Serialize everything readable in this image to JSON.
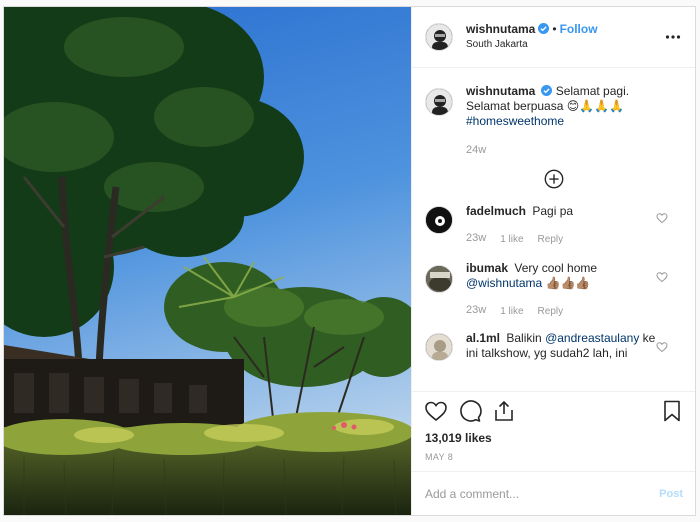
{
  "post": {
    "username": "wishnutama",
    "follow_label": "Follow",
    "location": "South Jakarta"
  },
  "caption": {
    "username": "wishnutama",
    "text": "Selamat pagi. Selamat berpuasa 😊🙏🙏🙏",
    "hashtag": "#homesweethome",
    "time": "24w"
  },
  "comments": [
    {
      "username": "fadelmuch",
      "text": "Pagi pa",
      "mention": "",
      "emoji": "",
      "time": "23w",
      "likes": "1 like",
      "reply": "Reply"
    },
    {
      "username": "ibumak",
      "text": "Very cool home",
      "mention": "@wishnutama",
      "emoji": " 👍🏽👍🏽👍🏽",
      "time": "23w",
      "likes": "1 like",
      "reply": "Reply"
    },
    {
      "username": "al.1ml",
      "text": "Balikin",
      "mention": "@andreastaulany",
      "text2": " ke ini talkshow, yg sudah2 lah, ini",
      "time": "",
      "likes": "",
      "reply": ""
    }
  ],
  "stats": {
    "likes": "13,019 likes",
    "date": "MAY 8"
  },
  "composer": {
    "placeholder": "Add a comment...",
    "post_label": "Post"
  },
  "colors": {
    "accent": "#3897f0",
    "post_disabled": "#b2dffc",
    "muted": "#999999",
    "sky": "#4a8cd6"
  },
  "icons": {
    "verified": "verified-badge-icon",
    "more": "more-options-icon",
    "load_more": "plus-circle-icon",
    "like": "heart-icon",
    "comment": "comment-bubble-icon",
    "share": "share-icon",
    "save": "bookmark-icon"
  }
}
